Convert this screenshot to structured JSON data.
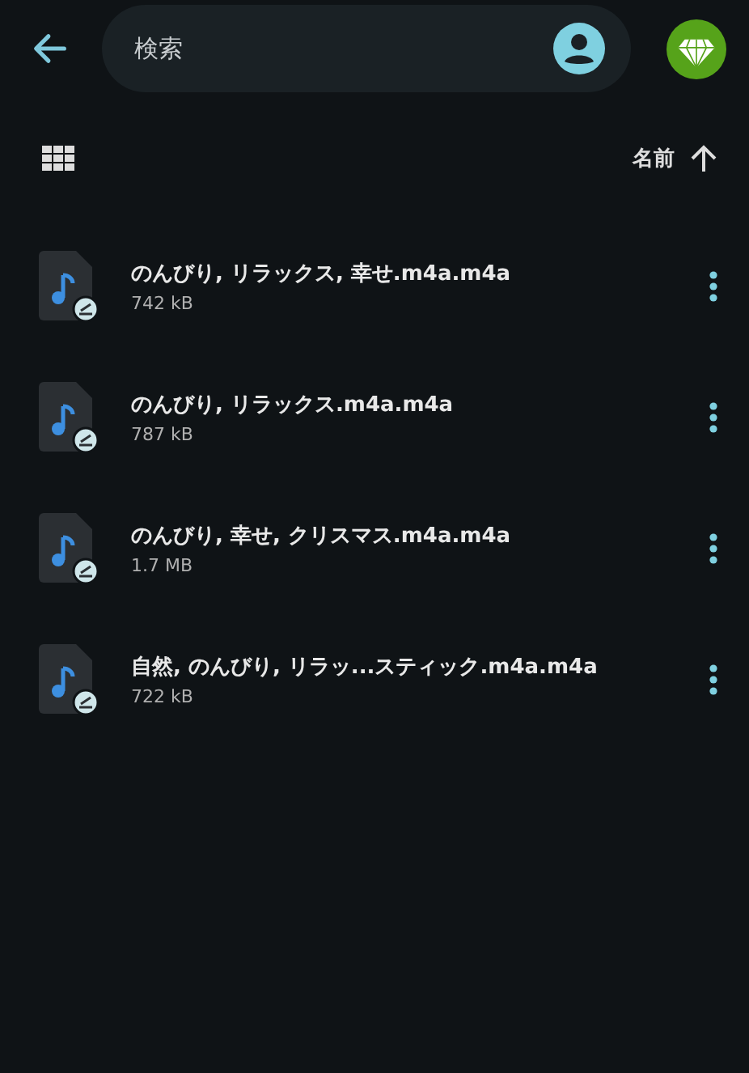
{
  "search": {
    "placeholder": "検索"
  },
  "sort_bar": {
    "label": "名前"
  },
  "files": [
    {
      "name": "のんびり, リラックス, 幸せ.m4a.m4a",
      "size": "742 kB"
    },
    {
      "name": "のんびり, リラックス.m4a.m4a",
      "size": "787 kB"
    },
    {
      "name": "のんびり, 幸せ, クリスマス.m4a.m4a",
      "size": "1.7 MB"
    },
    {
      "name": "自然, のんびり, リラッ...スティック.m4a.m4a",
      "size": "722 kB"
    }
  ]
}
